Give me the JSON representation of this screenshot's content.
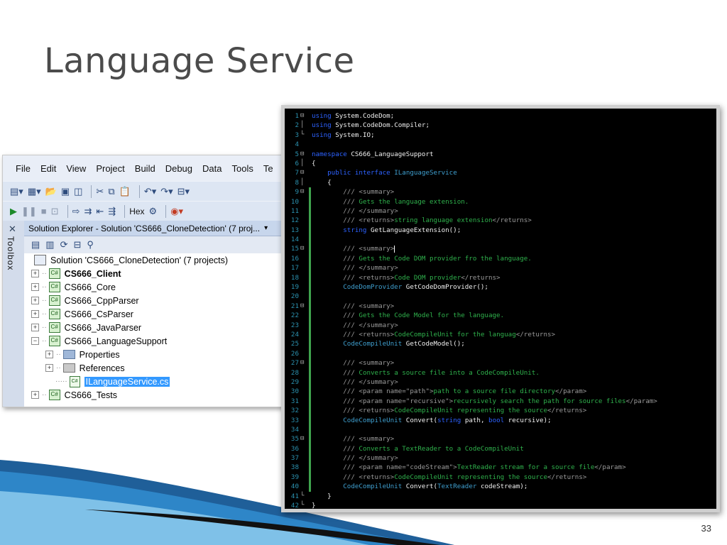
{
  "slide": {
    "title": "Language Service",
    "page_number": "33"
  },
  "vs": {
    "menu": [
      "File",
      "Edit",
      "View",
      "Project",
      "Build",
      "Debug",
      "Data",
      "Tools",
      "Te"
    ],
    "toolbar_hex": "Hex",
    "toolbox_label": "Toolbox",
    "solution_explorer": {
      "title": "Solution Explorer - Solution 'CS666_CloneDetection' (7 proj...",
      "solution": "Solution 'CS666_CloneDetection' (7 projects)",
      "projects": {
        "client": "CS666_Client",
        "core": "CS666_Core",
        "cpp": "CS666_CppParser",
        "cs": "CS666_CsParser",
        "java": "CS666_JavaParser",
        "lang": "CS666_LanguageSupport",
        "tests": "CS666_Tests"
      },
      "children": {
        "properties": "Properties",
        "references": "References",
        "file": "ILanguageService.cs"
      }
    }
  },
  "code": {
    "line_numbers": [
      "1",
      "2",
      "3",
      "4",
      "5",
      "6",
      "7",
      "8",
      "9",
      "10",
      "11",
      "12",
      "13",
      "14",
      "15",
      "16",
      "17",
      "18",
      "19",
      "20",
      "21",
      "22",
      "23",
      "24",
      "25",
      "26",
      "27",
      "28",
      "29",
      "30",
      "31",
      "32",
      "33",
      "34",
      "35",
      "36",
      "37",
      "38",
      "39",
      "40",
      "41",
      "42"
    ],
    "kw_using": "using",
    "kw_namespace": "namespace",
    "kw_public": "public",
    "kw_interface": "interface",
    "kw_string": "string",
    "kw_bool": "bool",
    "ns_codedom": "System.CodeDom;",
    "ns_compiler": "System.CodeDom.Compiler;",
    "ns_io": "System.IO;",
    "ns_name": "CS666_LanguageSupport",
    "iface_name": "ILanguageService",
    "brace_open": "{",
    "brace_close": "}",
    "doc_prefix": "///",
    "summary_open": "<summary>",
    "summary_close": "</summary>",
    "returns_open": "<returns>",
    "returns_close": "</returns>",
    "param_close": "</param>",
    "c_lang_ext": "Gets the language extension.",
    "r_lang_ext": "string language extension",
    "m_get_lang_ext": "GetLanguageExtension();",
    "c_dom_provider": "Gets the Code DOM provider fro the language.",
    "r_dom_provider": "Code DOM provider",
    "t_code_dom_provider": "CodeDomProvider",
    "m_get_provider": "GetCodeDomProvider();",
    "c_code_model": "Gets the Code Model for the language.",
    "t_compile_unit": "CodeCompileUnit",
    "r_code_model_tail": "for the languag",
    "m_get_model": "GetCodeModel();",
    "c_convert_file": "Converts a source file into a CodeCompileUnit.",
    "p_path_open": "<param name=\"path\">",
    "p_path_text": "path to a source file directory",
    "p_rec_open": "<param name=\"recursive\">",
    "p_rec_text": "recursively search the path for source files",
    "r_representing": "representing the source",
    "m_convert": "Convert(",
    "a_path": "path,",
    "a_recursive": "recursive);",
    "c_convert_reader": "Converts a TextReader to a CodeCompileUnit",
    "p_stream_open": "<param name=\"codeStream\">",
    "t_text_reader": "TextReader",
    "p_stream_text": "stream for a source file",
    "a_stream": "codeStream);"
  }
}
